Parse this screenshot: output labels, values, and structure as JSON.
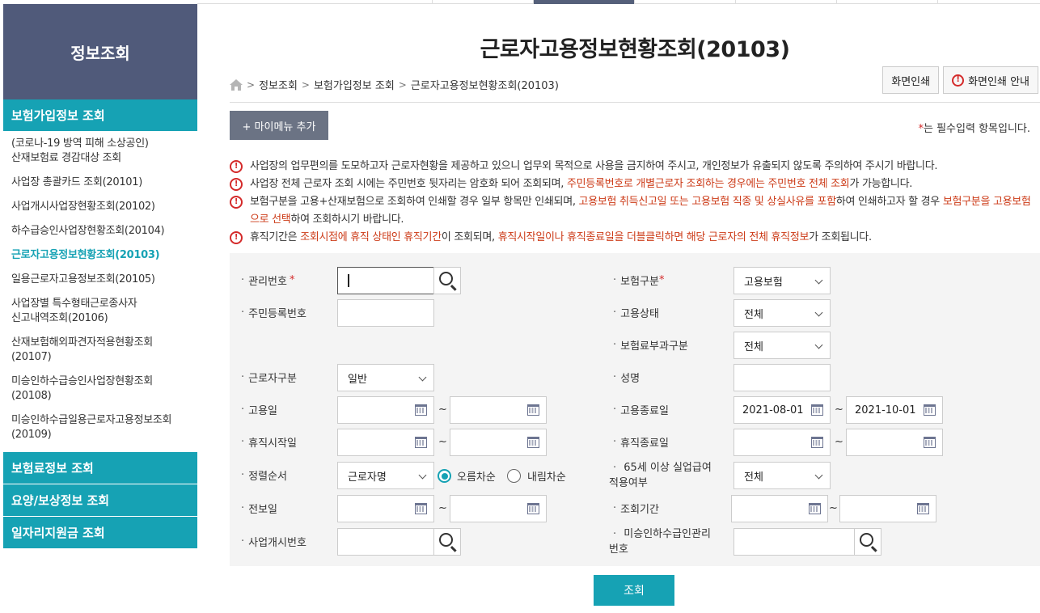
{
  "sidebar": {
    "title": "정보조회",
    "category_active": "보험가입정보 조회",
    "items": [
      "(코로나-19 방역 피해 소상공인)\n산재보험료 경감대상 조회",
      "사업장 총괄카드 조회(20101)",
      "사업개시사업장현황조회(20102)",
      "하수급승인사업장현황조회(20104)",
      "근로자고용정보현황조회(20103)",
      "일용근로자고용정보조회(20105)",
      "사업장별 특수형태근로종사자\n신고내역조회(20106)",
      "산재보험해외파견자적용현황조회\n(20107)",
      "미승인하수급승인사업장현황조회\n(20108)",
      "미승인하수급일용근로자고용정보조회\n(20109)"
    ],
    "active_index": 4,
    "categories": [
      "보험료정보 조회",
      "요양/보상정보 조회",
      "일자리지원금 조회"
    ]
  },
  "page": {
    "title": "근로자고용정보현황조회(20103)",
    "breadcrumb": [
      "정보조회",
      "보험가입정보 조회",
      "근로자고용정보현황조회(20103)"
    ],
    "print_button": "화면인쇄",
    "print_guide_button": "화면인쇄 안내",
    "mymenu_button": "+ 마이메뉴 추가",
    "required_star": "*",
    "required_note": "는 필수입력 항목입니다."
  },
  "notices": [
    [
      {
        "t": "사업장의 업무편의를 도모하고자 근로자현황을 제공하고 있으니 업무외 목적으로 사용을 금지하여 주시고, 개인정보가 유출되지 않도록 주의하여 주시기 바랍니다."
      }
    ],
    [
      {
        "t": "사업장 전체 근로자 조회 시에는 주민번호 뒷자리는 암호화 되어 조회되며, "
      },
      {
        "t": "주민등록번호로 개별근로자 조회하는 경우에는 주민번호 전체 조회",
        "hl": true
      },
      {
        "t": "가 가능합니다."
      }
    ],
    [
      {
        "t": "보험구분을 고용+산재보험으로 조회하여 인쇄할 경우 일부 항목만 인쇄되며, "
      },
      {
        "t": "고용보험 취득신고일 또는 고용보험 직종 및 상실사유를 포함",
        "hl": true
      },
      {
        "t": "하여 인쇄하고자 할 경우 "
      },
      {
        "t": "보험구분을 고용보험으로 선택",
        "hl": true
      },
      {
        "t": "하여 조회하시기 바랍니다."
      }
    ],
    [
      {
        "t": "휴직기간은 "
      },
      {
        "t": "조회시점에 휴직 상태인 휴직기간",
        "hl": true
      },
      {
        "t": "이 조회되며, "
      },
      {
        "t": "휴직시작일이나 휴직종료일을 더블클릭하면 해당 근로자의 전체 휴직정보",
        "hl": true
      },
      {
        "t": "가 조회됩니다."
      }
    ]
  ],
  "form": {
    "mgmt_no_label": "관리번호",
    "mgmt_no_value": "",
    "rrn_label": "주민등록번호",
    "rrn_value": "",
    "worker_type_label": "근로자구분",
    "worker_type_value": "일반",
    "hire_date_label": "고용일",
    "hire_from": "",
    "hire_to": "",
    "leave_start_label": "휴직시작일",
    "leave_start_from": "",
    "leave_start_to": "",
    "sort_label": "정렬순서",
    "sort_value": "근로자명",
    "sort_asc_label": "오름차순",
    "sort_desc_label": "내림차순",
    "report_date_label": "전보일",
    "report_from": "",
    "report_to": "",
    "biz_start_no_label": "사업개시번호",
    "biz_start_no_value": "",
    "insurance_type_label": "보험구분",
    "insurance_type_value": "고용보험",
    "employment_status_label": "고용상태",
    "employment_status_value": "전체",
    "premium_type_label": "보험료부과구분",
    "premium_type_value": "전체",
    "name_label": "성명",
    "name_value": "",
    "hire_end_label": "고용종료일",
    "hire_end_from": "2021-08-01",
    "hire_end_to": "2021-10-01",
    "leave_end_label": "휴직종료일",
    "leave_end_from": "",
    "leave_end_to": "",
    "over65_label_1": "65세 이상 실업급여",
    "over65_label_2": "적용여부",
    "over65_value": "전체",
    "query_period_label": "조회기간",
    "query_from": "",
    "query_to": "",
    "unapproved_label_1": "미승인하수급인관리",
    "unapproved_label_2": "번호",
    "unapproved_value": "",
    "tilde": "~"
  },
  "submit_label": "조회",
  "colors": {
    "teal": "#16a2b4",
    "navy": "#505a7a",
    "alert": "#d42a2a",
    "highlight": "#cc3a17"
  }
}
